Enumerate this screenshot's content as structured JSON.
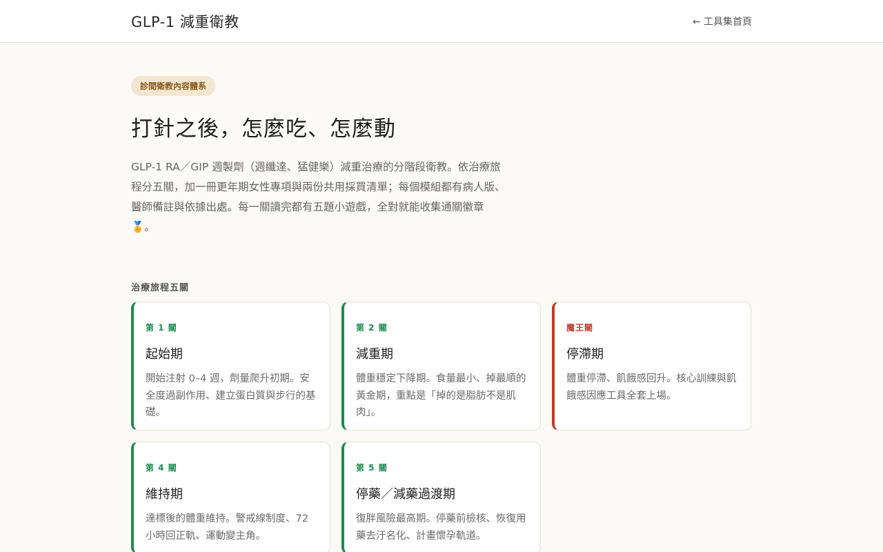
{
  "header": {
    "title": "GLP-1 減重衛教",
    "back_link": "← 工具集首頁"
  },
  "hero": {
    "badge": "診間衛教內容體系",
    "title": "打針之後，怎麼吃、怎麼動",
    "description": "GLP-1 RA／GIP 週製劑（週纖達、猛健樂）減重治療的分階段衛教。依治療旅程分五關，加一冊更年期女性專項與兩份共用採買清單；每個模組都有病人版、醫師備註與依據出處。每一關讀完都有五題小遊戲，全對就能收集通關徽章 🏅。"
  },
  "journey": {
    "section_label": "治療旅程五關",
    "stages": [
      {
        "tag": "第 1 關",
        "title": "起始期",
        "desc": "開始注射 0–4 週，劑量爬升初期。安全度過副作用、建立蛋白質與步行的基礎。"
      },
      {
        "tag": "第 2 關",
        "title": "減重期",
        "desc": "體重穩定下降期。食量最小、掉最順的黃金期，重點是「掉的是脂肪不是肌肉」。"
      },
      {
        "tag": "魔王關",
        "title": "停滯期",
        "desc": "體重停滯、飢餓感回升。核心訓練與飢餓感因應工具全套上場。"
      },
      {
        "tag": "第 4 關",
        "title": "維持期",
        "desc": "達標後的體重維持。警戒線制度、72 小時回正軌、運動變主角。"
      },
      {
        "tag": "第 5 關",
        "title": "停藥／減藥過渡期",
        "desc": "復胖風險最高期。停藥前檢核、恢復用藥去汙名化、計畫懷孕軌道。"
      }
    ]
  },
  "colors": {
    "accent_green": "#1e8a4f",
    "accent_red": "#c23a2a",
    "badge_bg": "#f3e7d2"
  }
}
